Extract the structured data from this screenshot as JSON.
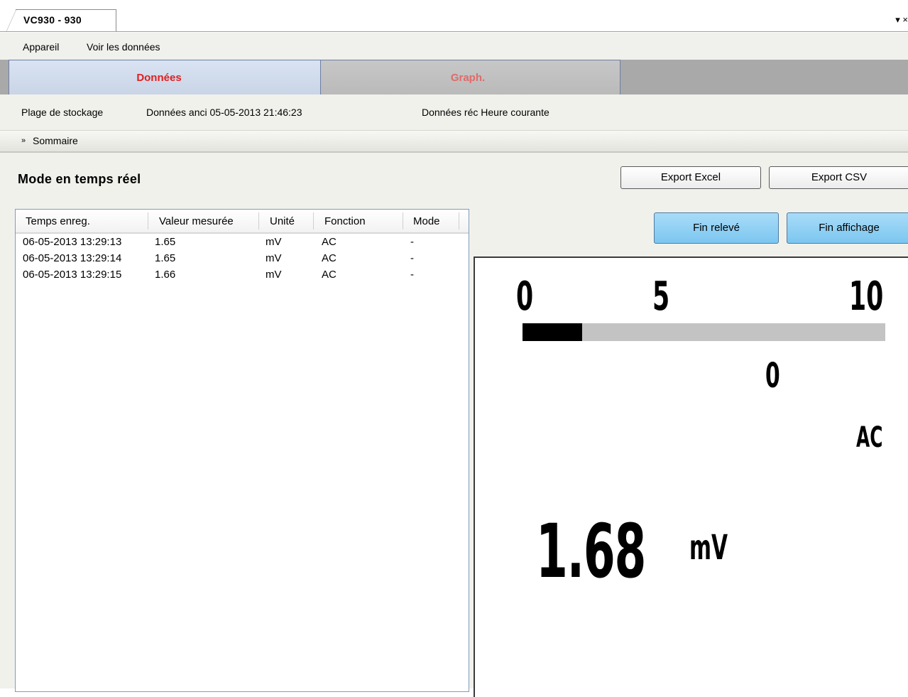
{
  "window": {
    "doc_tab_label": "VC930 - 930",
    "controls_label": "▾ ×"
  },
  "menu": {
    "items": [
      "Appareil",
      "Voir les données"
    ]
  },
  "tabs": {
    "donnees": "Données",
    "graph": "Graph."
  },
  "info": {
    "storage_label": "Plage de stockage",
    "old_data": "Données anci 05-05-2013 21:46:23",
    "recent_data": "Données réc Heure courante"
  },
  "summary": {
    "icon": "double-chevron-down-icon",
    "label": "Sommaire"
  },
  "content": {
    "mode_title": "Mode en temps réel",
    "buttons": {
      "export_excel": "Export Excel",
      "export_csv": "Export CSV",
      "fin_releve": "Fin relevé",
      "fin_affichage": "Fin affichage"
    }
  },
  "table": {
    "columns": [
      "Temps enreg.",
      "Valeur mesurée",
      "Unité",
      "Fonction",
      "Mode"
    ],
    "rows": [
      [
        "06-05-2013 13:29:13",
        "1.65",
        "mV",
        "AC",
        "-"
      ],
      [
        "06-05-2013 13:29:14",
        "1.65",
        "mV",
        "AC",
        "-"
      ],
      [
        "06-05-2013 13:29:15",
        "1.66",
        "mV",
        "AC",
        "-"
      ]
    ]
  },
  "display": {
    "scale_min": "0",
    "scale_mid": "5",
    "scale_max": "10",
    "bar_fraction": 0.165,
    "secondary_value": "0",
    "function": "AC",
    "reading": "1.68",
    "unit": "mV"
  },
  "colors": {
    "active_tab_text": "#e02020",
    "inactive_tab_text": "#e06a6a",
    "button_blue": "#7cc6f0"
  }
}
